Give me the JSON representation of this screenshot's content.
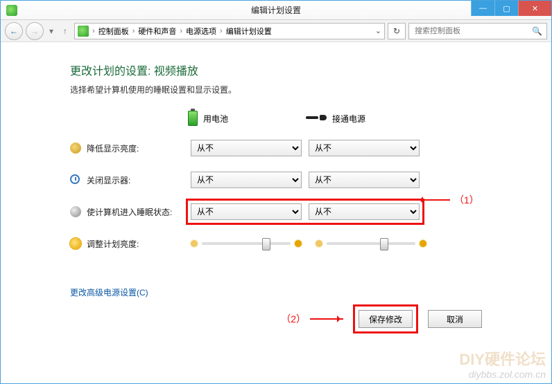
{
  "window": {
    "title": "编辑计划设置"
  },
  "breadcrumb": {
    "items": [
      "控制面板",
      "硬件和声音",
      "电源选项",
      "编辑计划设置"
    ]
  },
  "search": {
    "placeholder": "搜索控制面板"
  },
  "page": {
    "title": "更改计划的设置: 视频播放",
    "subtitle": "选择希望计算机使用的睡眠设置和显示设置。"
  },
  "columns": {
    "battery": "用电池",
    "ac": "接通电源"
  },
  "rows": {
    "dim": {
      "label": "降低显示亮度:",
      "battery": "从不",
      "ac": "从不"
    },
    "off": {
      "label": "关闭显示器:",
      "battery": "从不",
      "ac": "从不"
    },
    "sleep": {
      "label": "使计算机进入睡眠状态:",
      "battery": "从不",
      "ac": "从不"
    },
    "bright": {
      "label": "调整计划亮度:"
    }
  },
  "link": "更改高级电源设置(C)",
  "buttons": {
    "save": "保存修改",
    "cancel": "取消"
  },
  "annotations": {
    "a1": "（1）",
    "a2": "（2）"
  },
  "watermark": {
    "line1": "DIY硬件论坛",
    "line2": "diybbs.zol.com.cn"
  }
}
